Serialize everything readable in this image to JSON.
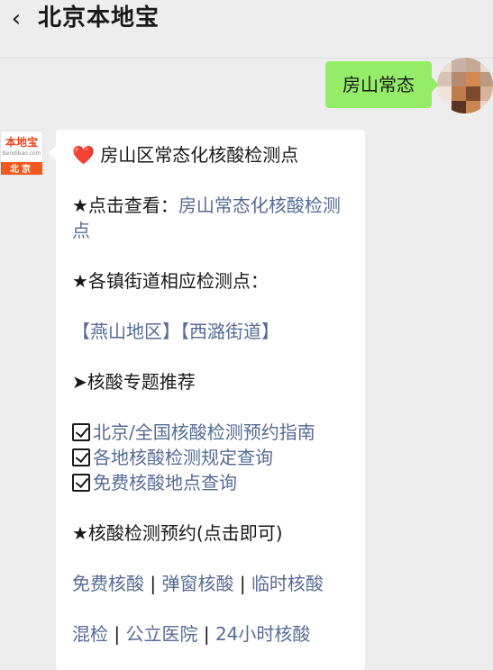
{
  "header": {
    "title": "北京本地宝",
    "back_icon": "chevron-left-icon"
  },
  "user_message": {
    "text": "房山常态"
  },
  "bot": {
    "logo": {
      "name": "本地宝",
      "site": "Bendibao.com",
      "city": "北京"
    },
    "heading": "房山区常态化核酸检测点",
    "heart_glyph": "❤️",
    "click_view_prefix": "★点击查看：",
    "click_view_link": "房山常态化核酸检测点",
    "towns_heading": "★各镇街道相应检测点：",
    "town_links": [
      "【燕山地区】",
      "【西潞街道】"
    ],
    "topic_heading": "➤核酸专题推荐",
    "topic_links": [
      "北京/全国核酸检测预约指南",
      "各地核酸检测规定查询",
      "免费核酸地点查询"
    ],
    "booking_heading": "★核酸检测预约(点击即可)",
    "booking_row1": [
      "免费核酸",
      "弹窗核酸",
      "临时核酸"
    ],
    "booking_row2": [
      "混检",
      "公立医院",
      "24小时核酸"
    ],
    "separator": "|"
  },
  "colors": {
    "background": "#ededed",
    "user_bubble": "#95ec69",
    "link": "#576b95",
    "logo_orange": "#f05a1e"
  }
}
